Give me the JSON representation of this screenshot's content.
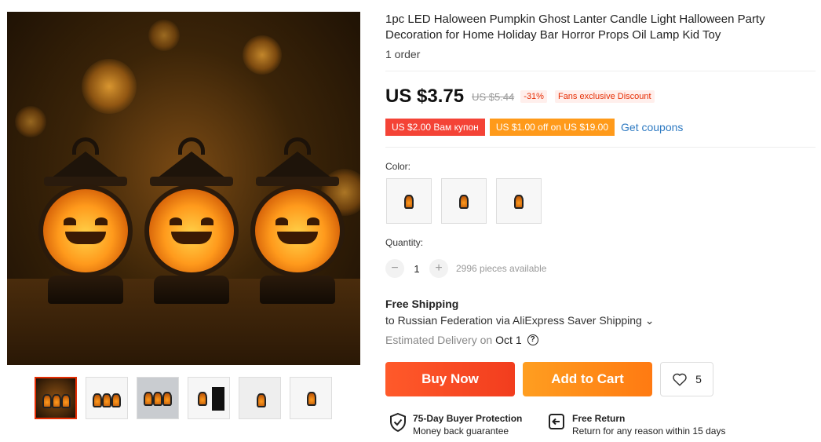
{
  "product": {
    "title": "1pc LED Haloween Pumpkin Ghost Lanter Candle Light Halloween Party Decoration for Home Holiday Bar Horror Props Oil Lamp Kid Toy",
    "orders": "1 order"
  },
  "pricing": {
    "price": "US $3.75",
    "old_price": "US $5.44",
    "discount": "-31%",
    "fans_badge": "Fans exclusive Discount"
  },
  "coupons": {
    "coupon1": "US $2.00 Вам купон",
    "coupon2": "US $1.00 off on US $19.00",
    "get_coupons": "Get coupons"
  },
  "color": {
    "label": "Color:",
    "options": [
      "option-1",
      "option-2",
      "option-3"
    ]
  },
  "quantity": {
    "label": "Quantity:",
    "minus": "−",
    "value": "1",
    "plus": "+",
    "available": "2996 pieces available"
  },
  "shipping": {
    "title": "Free Shipping",
    "to": "to Russian Federation via AliExpress Saver Shipping ⌄",
    "eta_label": "Estimated Delivery on",
    "eta_date": "Oct 1",
    "help": "?"
  },
  "actions": {
    "buy_now": "Buy Now",
    "add_to_cart": "Add to Cart",
    "wishlist_count": "5"
  },
  "guarantees": {
    "protection_title": "75-Day Buyer Protection",
    "protection_sub": "Money back guarantee",
    "return_title": "Free Return",
    "return_sub": "Return for any reason within 15 days"
  },
  "colors": {
    "accent_red": "#e62e04",
    "buy_button": "#f23d1e",
    "cart_button": "#ff7a12",
    "link": "#2e7ac2"
  }
}
